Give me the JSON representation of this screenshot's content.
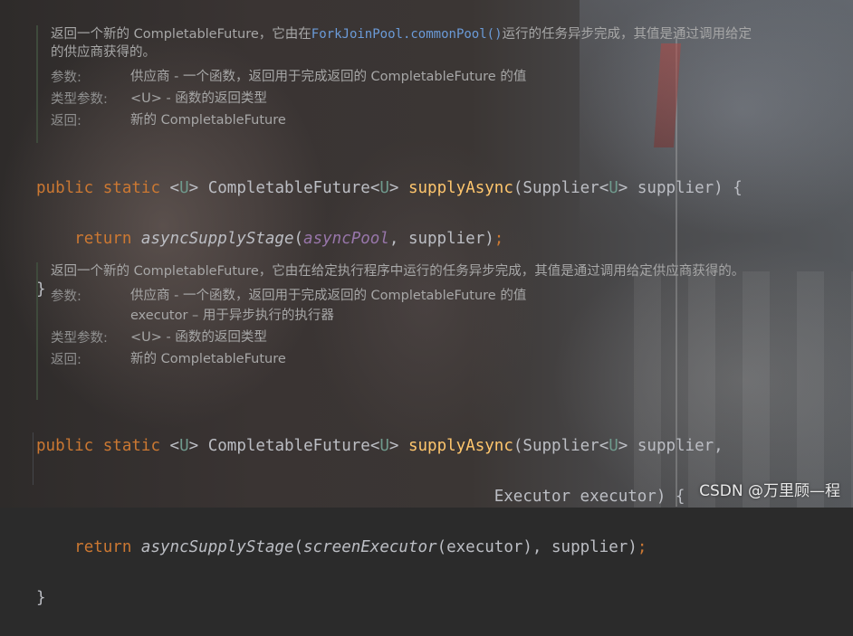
{
  "doc1": {
    "desc_a": "返回一个新的 CompletableFuture，它由在",
    "desc_link": "ForkJoinPool.commonPool()",
    "desc_b": "运行的任务异步完成，其值是通过调用给定的供应商获得的。",
    "params_label": "参数:",
    "params_value": "供应商 - 一个函数，返回用于完成返回的 CompletableFuture 的值",
    "type_label": "类型参数:",
    "type_value": "<U> - 函数的返回类型",
    "return_label": "返回:",
    "return_value": "新的 CompletableFuture"
  },
  "code1": {
    "l1_public": "public",
    "l1_static": "static",
    "l1_lt": "<",
    "l1_U": "U",
    "l1_gt": ">",
    "l1_cf": " CompletableFuture<",
    "l1_U2": "U",
    "l1_gt2": "> ",
    "l1_method": "supplyAsync",
    "l1_args_a": "(Supplier<",
    "l1_U3": "U",
    "l1_args_b": "> supplier) {",
    "l2_return": "return",
    "l2_call": "asyncSupplyStage",
    "l2_open": "(",
    "l2_field": "asyncPool",
    "l2_rest": ", supplier)",
    "l2_semi": ";",
    "l3": "}"
  },
  "doc2": {
    "desc": "返回一个新的 CompletableFuture，它由在给定执行程序中运行的任务异步完成，其值是通过调用给定供应商获得的。",
    "params_label": "参数:",
    "params_value1": "供应商 - 一个函数，返回用于完成返回的 CompletableFuture 的值",
    "params_value2": "executor – 用于异步执行的执行器",
    "type_label": "类型参数:",
    "type_value": "<U> - 函数的返回类型",
    "return_label": "返回:",
    "return_value": "新的 CompletableFuture"
  },
  "code2": {
    "l1_public": "public",
    "l1_static": "static",
    "l1_lt": "<",
    "l1_U": "U",
    "l1_gt": ">",
    "l1_cf": " CompletableFuture<",
    "l1_U2": "U",
    "l1_gt2": "> ",
    "l1_method": "supplyAsync",
    "l1_args_a": "(Supplier<",
    "l1_U3": "U",
    "l1_args_b": "> supplier,",
    "l2_args": "Executor executor) {",
    "l3_return": "return",
    "l3_call": "asyncSupplyStage",
    "l3_open": "(",
    "l3_call2": "screenExecutor",
    "l3_rest": "(executor), supplier)",
    "l3_semi": ";",
    "l4": "}"
  },
  "watermark": "CSDN @万里顾—程"
}
